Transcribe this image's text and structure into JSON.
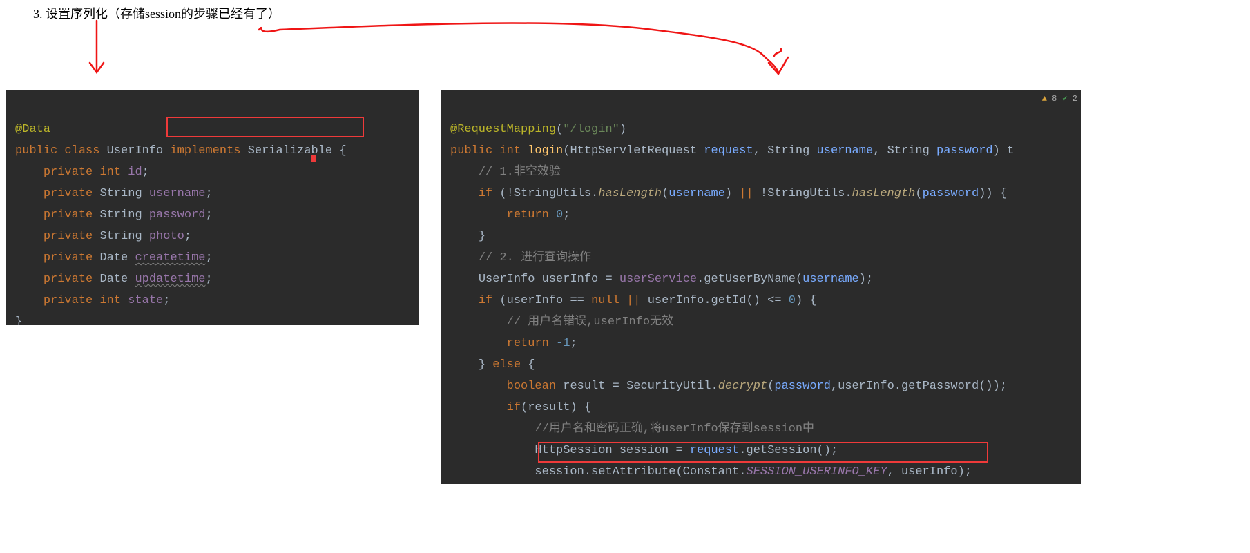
{
  "heading": "3. 设置序列化（存储session的步骤已经有了）",
  "left": {
    "ann": "@Data",
    "kw_public": "public",
    "kw_class": "class",
    "cls_name": "UserInfo",
    "kw_implements": "implements",
    "iface": "Serializable",
    "brace_open": " {",
    "kw_private": "private",
    "t_int": "int",
    "t_string": "String",
    "t_date": "Date",
    "f_id": "id",
    "f_username": "username",
    "f_password": "password",
    "f_photo": "photo",
    "f_createtime": "createtime",
    "f_updatetime": "updatetime",
    "f_state": "state",
    "brace_close": "}",
    "semi": ";"
  },
  "right": {
    "ann": "@RequestMapping",
    "path": "\"/login\"",
    "kw_public": "public",
    "t_int": "int",
    "fn_login": "login",
    "t_req": "HttpServletRequest",
    "p_request": "request",
    "t_string": "String",
    "p_username": "username",
    "p_password": "password",
    "c1": "// 1.非空效验",
    "kw_if": "if",
    "neg": "!",
    "su": "StringUtils",
    "hasLength": "hasLength",
    "or": "||",
    "brace_open": "{",
    "kw_return": "return",
    "num0": "0",
    "semi": ";",
    "brace_close": "}",
    "c2": "// 2. 进行查询操作",
    "ui_type": "UserInfo",
    "ui_var": "userInfo",
    "eq": "=",
    "usvc": "userService",
    "getByName": "getUserByName",
    "kw_null": "null",
    "eqeq": "==",
    "getId": "getId",
    "lez": "<=",
    "c3": "// 用户名错误,userInfo无效",
    "neg1": "-1",
    "kw_else": "else",
    "t_bool": "boolean",
    "v_result": "result",
    "secu": "SecurityUtil",
    "decrypt": "decrypt",
    "getPwd": "getPassword",
    "c4": "//用户名和密码正确,将userInfo保存到session中",
    "t_sess": "HttpSession",
    "v_session": "session",
    "getSession": "getSession",
    "setAttr": "setAttribute",
    "constant": "Constant",
    "sess_key": "SESSION_USERINFO_KEY",
    "num1": "1",
    "comma": ","
  },
  "warn": {
    "tri": "▲",
    "n8": "8",
    "chk": "✔",
    "n2": "2"
  }
}
